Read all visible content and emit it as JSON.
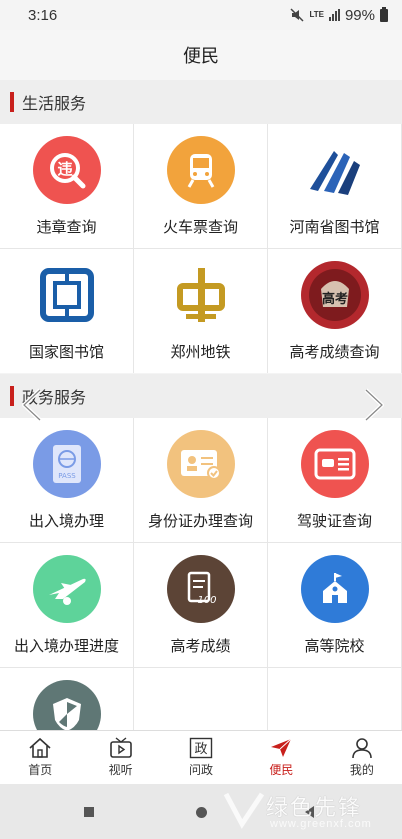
{
  "status": {
    "time": "3:16",
    "network": "LTE",
    "battery": "99%"
  },
  "header": {
    "title": "便民"
  },
  "sections": [
    {
      "title": "生活服务",
      "items": [
        {
          "label": "违章查询",
          "icon": "violation-search-icon",
          "color": "#ef5350"
        },
        {
          "label": "火车票查询",
          "icon": "train-icon",
          "color": "#f2a33c"
        },
        {
          "label": "河南省图书馆",
          "icon": "henan-library-logo",
          "color": "#1e4f9a"
        },
        {
          "label": "国家图书馆",
          "icon": "national-library-logo",
          "color": "#1a5ea8"
        },
        {
          "label": "郑州地铁",
          "icon": "zhengzhou-metro-logo",
          "color": "#c49a22"
        },
        {
          "label": "高考成绩查询",
          "icon": "gaokao-icon",
          "color": "#b3282d"
        }
      ]
    },
    {
      "title": "政务服务",
      "items": [
        {
          "label": "出入境办理",
          "icon": "passport-icon",
          "color": "#7a9be6"
        },
        {
          "label": "身份证办理查询",
          "icon": "id-card-icon",
          "color": "#f2c27e"
        },
        {
          "label": "驾驶证查询",
          "icon": "driver-license-icon",
          "color": "#ef5350"
        },
        {
          "label": "出入境办理进度",
          "icon": "airplane-icon",
          "color": "#5ed39a"
        },
        {
          "label": "高考成绩",
          "icon": "exam-score-icon",
          "color": "#5c4436"
        },
        {
          "label": "高等院校",
          "icon": "university-icon",
          "color": "#2f7bd8"
        },
        {
          "label": "",
          "icon": "shield-icon",
          "color": "#5f7775"
        }
      ]
    }
  ],
  "tabs": [
    {
      "label": "首页",
      "icon": "home-icon"
    },
    {
      "label": "视听",
      "icon": "tv-icon"
    },
    {
      "label": "问政",
      "icon": "zheng-icon",
      "glyph": "政"
    },
    {
      "label": "便民",
      "icon": "paper-plane-icon",
      "active": true
    },
    {
      "label": "我的",
      "icon": "person-icon"
    }
  ],
  "watermark": {
    "text": "绿色先锋",
    "sub": "www.greenxf.com"
  },
  "colors": {
    "accent": "#c8201c"
  }
}
